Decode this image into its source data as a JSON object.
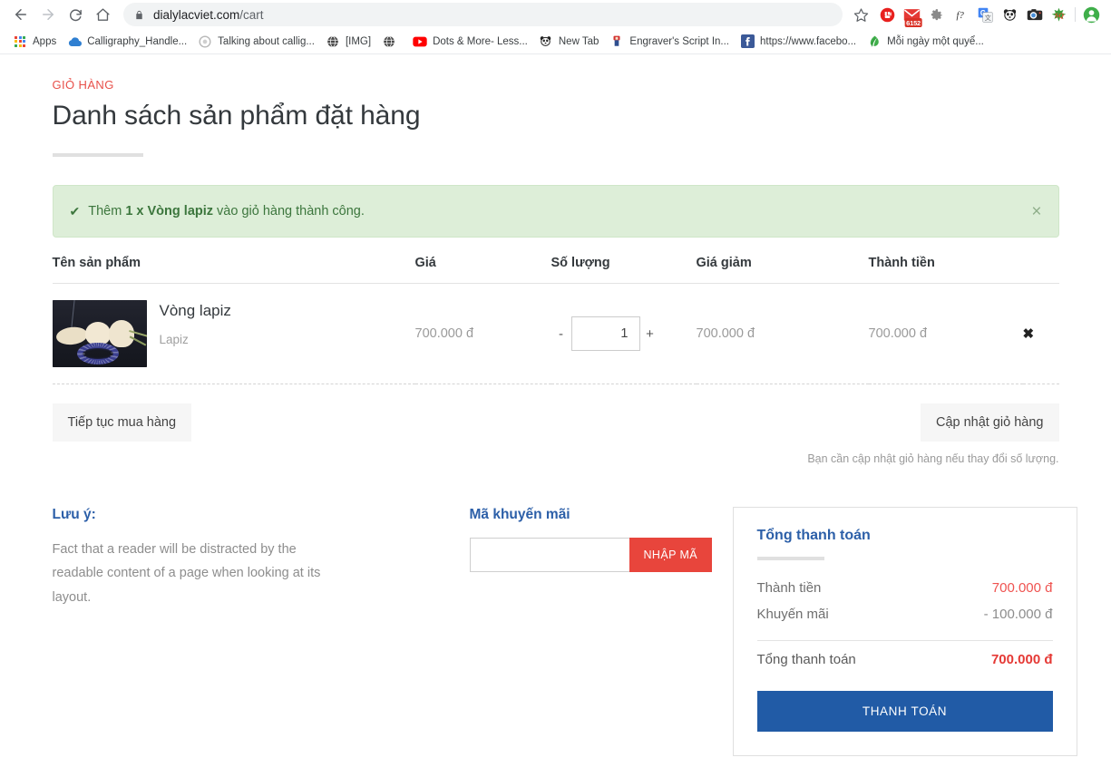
{
  "browser": {
    "nav": {
      "back": "Back",
      "forward": "Forward",
      "reload": "Reload",
      "home": "Home"
    },
    "omnibox": {
      "lock_icon": "lock-icon",
      "url_host": "dialylacviet.com",
      "url_path": "/cart",
      "full_url": "dialylacviet.com/cart"
    },
    "star_label": "Bookmark this page",
    "extensions": [
      {
        "name": "adblock-extension-icon",
        "badge": ""
      },
      {
        "name": "mail-extension-icon",
        "badge": "6152"
      },
      {
        "name": "settings-gear-extension-icon",
        "badge": ""
      },
      {
        "name": "font-extension-icon",
        "badge": ""
      },
      {
        "name": "google-translate-extension-icon",
        "badge": ""
      },
      {
        "name": "panda-extension-icon",
        "badge": ""
      },
      {
        "name": "camera-extension-icon",
        "badge": ""
      },
      {
        "name": "seoquake-extension-icon",
        "badge": ""
      },
      {
        "name": "profile-avatar-icon",
        "badge": ""
      }
    ],
    "bookmarks": [
      {
        "label": "Apps",
        "icon": "apps-grid-icon"
      },
      {
        "label": "Calligraphy_Handle...",
        "icon": "cloud-icon"
      },
      {
        "label": "Talking about callig...",
        "icon": "circle-icon"
      },
      {
        "label": "[IMG]",
        "icon": "globe-icon"
      },
      {
        "label": "",
        "icon": "globe-icon"
      },
      {
        "label": "Dots & More- Less...",
        "icon": "youtube-icon"
      },
      {
        "label": "New Tab",
        "icon": "panda-icon"
      },
      {
        "label": "Engraver's Script In...",
        "icon": "red-icon"
      },
      {
        "label": "https://www.facebo...",
        "icon": "facebook-icon"
      },
      {
        "label": "Mỗi ngày một quyể...",
        "icon": "leaf-icon"
      }
    ]
  },
  "header": {
    "eyebrow": "GIỎ HÀNG",
    "title": "Danh sách sản phẩm đặt hàng"
  },
  "alert": {
    "check_icon": "check-icon",
    "prefix": "Thêm ",
    "bold": "1 x Vòng lapiz",
    "suffix": " vào giỏ hàng thành công.",
    "close_icon": "close-icon",
    "close_label": "×",
    "bg_color": "#ddeed8",
    "text_color": "#3c763d"
  },
  "table": {
    "headers": {
      "name": "Tên sản phẩm",
      "price": "Giá",
      "quantity": "Số lượng",
      "discount": "Giá giảm",
      "total": "Thành tiền"
    },
    "rows": [
      {
        "image_alt": "Vòng lapiz - lapis bead bracelet with lotus buds on dark background",
        "name": "Vòng lapiz",
        "subtitle": "Lapiz",
        "price": "700.000 đ",
        "minus": "-",
        "quantity": "1",
        "plus": "+",
        "discount": "700.000 đ",
        "total": "700.000 đ",
        "remove_icon": "remove-x-icon",
        "remove_label": "✖"
      }
    ]
  },
  "actions": {
    "continue_shopping": "Tiếp tục mua hàng",
    "update_cart": "Cập nhật giỏ hàng",
    "hint": "Bạn cần cập nhật giỏ hàng nếu thay đổi số lượng."
  },
  "note": {
    "title": "Lưu ý:",
    "body": "Fact that a reader will be distracted by the readable content of a page when looking at its layout."
  },
  "promo": {
    "title": "Mã khuyến mãi",
    "input_value": "",
    "input_placeholder": "",
    "button": "NHẬP MÃ",
    "button_color": "#e8453c"
  },
  "summary": {
    "title": "Tổng thanh toán",
    "subtotal_label": "Thành tiền",
    "subtotal_value": "700.000 đ",
    "discount_label": "Khuyến mãi",
    "discount_value": "- 100.000 đ",
    "total_label": "Tổng thanh toán",
    "total_value": "700.000 đ",
    "checkout_button": "THANH TOÁN",
    "checkout_color": "#215ba6",
    "accent_blue": "#2c5fa8",
    "accent_red": "#e53935"
  }
}
